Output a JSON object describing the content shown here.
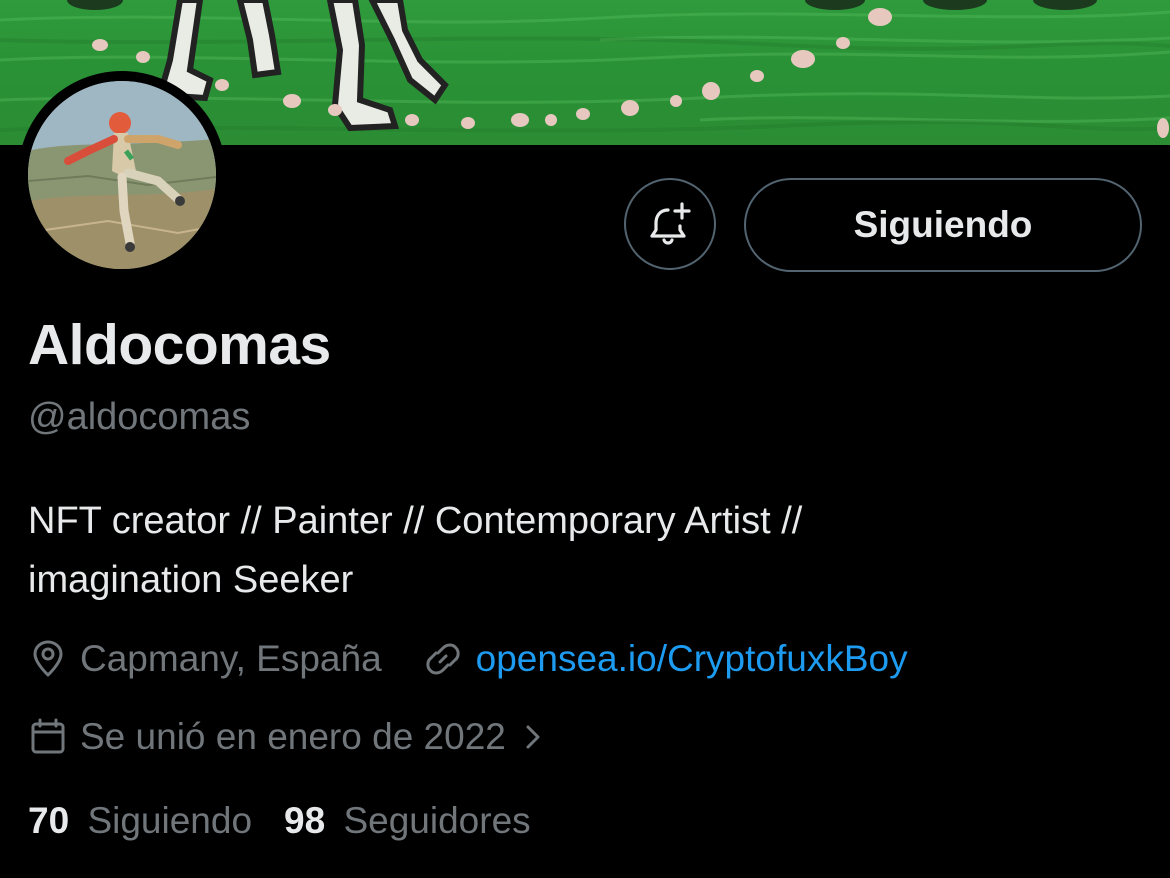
{
  "profile": {
    "display_name": "Aldocomas",
    "handle": "@aldocomas",
    "bio_line1": "NFT creator // Painter // Contemporary Artist //",
    "bio_line2": "imagination Seeker",
    "location": "Capmany, España",
    "website": "opensea.io/CryptofuxkBoy",
    "joined": "Se unió en enero de 2022"
  },
  "actions": {
    "follow_label": "Siguiendo",
    "notify_icon": "bell-plus-icon"
  },
  "stats": {
    "following_count": "70",
    "following_label": "Siguiendo",
    "followers_count": "98",
    "followers_label": "Seguidores"
  },
  "icons": {
    "location": "map-pin-icon",
    "website": "link-icon",
    "joined": "calendar-icon",
    "joined_more": "chevron-right-icon"
  },
  "colors": {
    "background": "#000000",
    "text_primary": "#e7e9ea",
    "text_secondary": "#71767b",
    "link": "#1d9bf0",
    "border": "#536471",
    "banner_green": "#2b8f35"
  }
}
